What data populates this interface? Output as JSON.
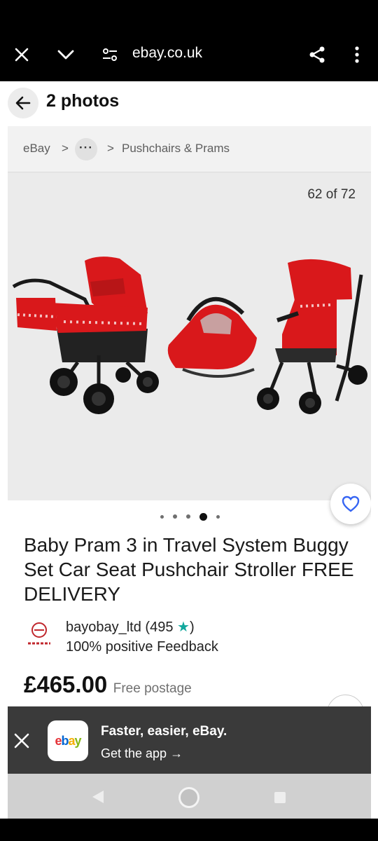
{
  "browser": {
    "url": "ebay.co.uk",
    "icons": [
      "close-icon",
      "chevron-down-icon",
      "site-settings-icon",
      "share-icon",
      "more-icon"
    ]
  },
  "gallery": {
    "title": "2 photos",
    "back_icon": "arrow-left-icon"
  },
  "breadcrumb": {
    "root": "eBay",
    "separator": ">",
    "more": "···",
    "category": "Pushchairs & Prams"
  },
  "photo": {
    "counter": "62 of 72"
  },
  "carousel": {
    "dot_count": 5,
    "active_index": 3
  },
  "listing": {
    "title": "Baby Pram 3 in Travel System Buggy Set Car Seat Pushchair Stroller FREE DELIVERY",
    "seller": {
      "name": "bayobay_ltd (495 ",
      "star": "★",
      "name_end": ")",
      "feedback": "100% positive Feedback"
    },
    "price": "£465.00",
    "postage": "Free postage"
  },
  "help": {
    "label": "?"
  },
  "app_banner": {
    "title": "Faster, easier, eBay.",
    "cta": "Get the app →",
    "logo_letters": [
      "e",
      "b",
      "a",
      "y"
    ],
    "logo_colors": [
      "#e53238",
      "#0064d2",
      "#f5af02",
      "#86b817"
    ]
  },
  "colors": {
    "accent_blue": "#3665f3",
    "pram_red": "#e01919",
    "star_teal": "#12a89d"
  }
}
